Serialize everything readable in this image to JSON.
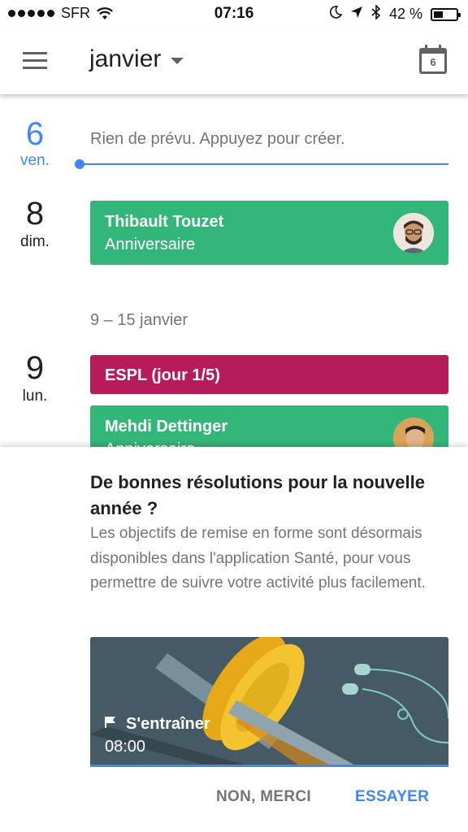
{
  "status_bar": {
    "carrier": "SFR",
    "time": "07:16",
    "battery_percent": "42 %",
    "battery_level": 0.42
  },
  "app_bar": {
    "month": "janvier",
    "calendar_icon_day": "6"
  },
  "agenda": {
    "days": [
      {
        "num": "6",
        "dow": "ven.",
        "empty_text": "Rien de prévu. Appuyez pour créer."
      },
      {
        "num": "8",
        "dow": "dim."
      },
      {
        "num": "9",
        "dow": "lun."
      }
    ],
    "week_range": "9 – 15 janvier",
    "events": [
      {
        "title": "Thibault Touzet",
        "subtitle": "Anniversaire",
        "color": "#33b679"
      },
      {
        "title": "ESPL (jour 1/5)",
        "color": "#b71c5a"
      },
      {
        "title": "Mehdi Dettinger",
        "subtitle": "Anniversaire",
        "color": "#33b679"
      }
    ]
  },
  "sheet": {
    "title": "De bonnes résolutions pour la nouvelle année ?",
    "body": "Les objectifs de remise en forme sont désormais disponibles dans l'application Santé, pour vous permettre de suivre votre activité plus facilement.",
    "promo_label": "S'entraîner",
    "promo_time": "08:00",
    "dismiss_label": "NON, MERCI",
    "accept_label": "ESSAYER"
  },
  "colors": {
    "accent": "#4285f4",
    "birthday": "#33b679",
    "espl": "#b71c5a",
    "promo_bg": "#455a64"
  }
}
